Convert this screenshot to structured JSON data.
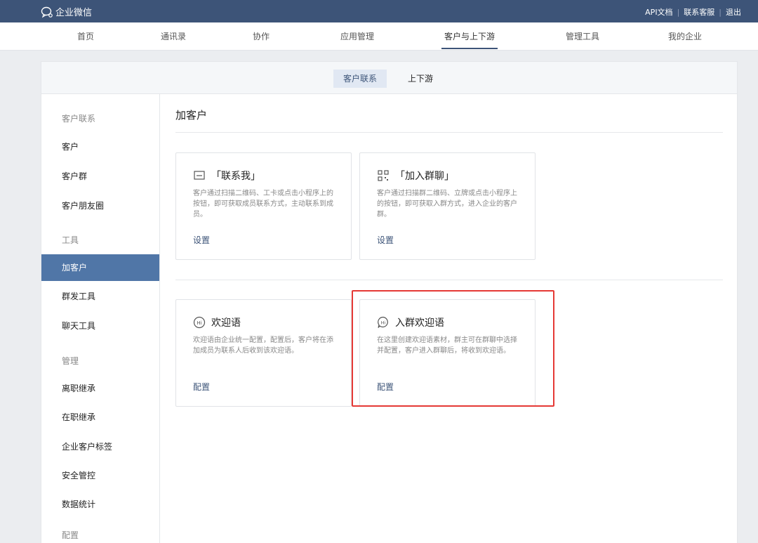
{
  "topbar": {
    "brand": "企业微信",
    "links": [
      "API文档",
      "联系客服",
      "退出"
    ]
  },
  "nav": {
    "items": [
      "首页",
      "通讯录",
      "协作",
      "应用管理",
      "客户与上下游",
      "管理工具",
      "我的企业"
    ],
    "active": "客户与上下游"
  },
  "subtabs": [
    "客户联系",
    "上下游"
  ],
  "sidebar": {
    "items": [
      "客户联系",
      "客户",
      "客户群",
      "客户朋友圈",
      "工具",
      "加客户",
      "群发工具",
      "聊天工具",
      "管理",
      "离职继承",
      "在职继承",
      "企业客户标签",
      "安全管控",
      "数据统计",
      "配置"
    ]
  },
  "content": {
    "title": "加客户",
    "cards": [
      {
        "title": "「联系我」",
        "desc": "客户通过扫描二维码、工卡或点击小程序上的按钮，即可获取成员联系方式，主动联系到成员。",
        "link": "设置",
        "icon": "message-icon"
      },
      {
        "title": "「加入群聊」",
        "desc": "客户通过扫描群二维码、立牌或点击小程序上的按钮，即可获取入群方式，进入企业的客户群。",
        "link": "设置",
        "icon": "qrcode-icon"
      },
      {
        "title": "欢迎语",
        "desc": "欢迎语由企业统一配置，配置后，客户将在添加成员为联系人后收到该欢迎语。",
        "link": "配置",
        "icon": "hi-icon"
      },
      {
        "title": "入群欢迎语",
        "desc": "在这里创建欢迎语素材，群主可在群聊中选择并配置，客户进入群聊后，将收到欢迎语。",
        "link": "配置",
        "icon": "hi-chat-icon"
      }
    ]
  },
  "colors": {
    "topbar": "#3d5478",
    "accent": "#5076a7",
    "highlight": "#e53935"
  }
}
